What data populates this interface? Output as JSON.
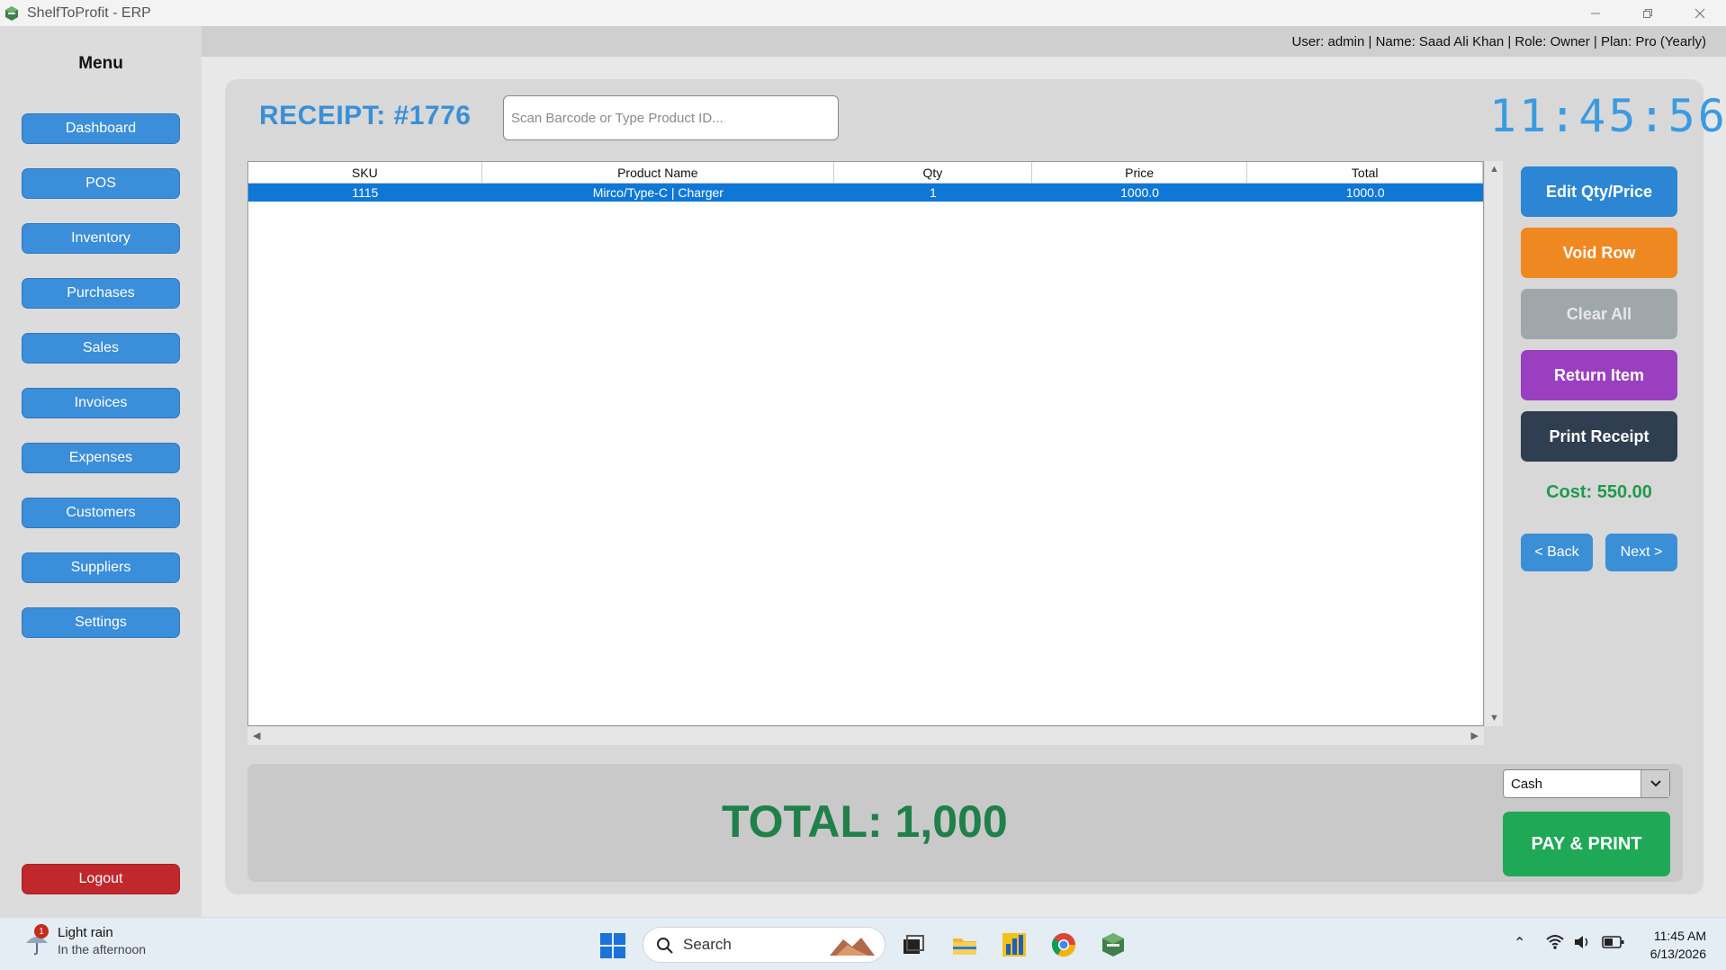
{
  "window": {
    "title": "ShelfToProfit - ERP"
  },
  "sidebar": {
    "menu_title": "Menu",
    "items": [
      {
        "label": "Dashboard"
      },
      {
        "label": "POS"
      },
      {
        "label": "Inventory"
      },
      {
        "label": "Purchases"
      },
      {
        "label": "Sales"
      },
      {
        "label": "Invoices"
      },
      {
        "label": "Expenses"
      },
      {
        "label": "Customers"
      },
      {
        "label": "Suppliers"
      },
      {
        "label": "Settings"
      }
    ],
    "logout_label": "Logout"
  },
  "header": {
    "user_info": "User: admin | Name: Saad Ali Khan | Role: Owner | Plan: Pro (Yearly)"
  },
  "pos": {
    "receipt_title": "RECEIPT: #1776",
    "scan_placeholder": "Scan Barcode or Type Product ID...",
    "clock": "11:45:56"
  },
  "table": {
    "columns": [
      "SKU",
      "Product Name",
      "Qty",
      "Price",
      "Total"
    ],
    "rows": [
      {
        "sku": "1115",
        "name": "Mirco/Type-C | Charger",
        "qty": "1",
        "price": "1000.0",
        "total": "1000.0",
        "selected": true
      }
    ]
  },
  "actions": {
    "edit": "Edit Qty/Price",
    "void": "Void Row",
    "clear": "Clear All",
    "return": "Return Item",
    "print": "Print Receipt",
    "cost": "Cost: 550.00",
    "back": "< Back",
    "next": "Next >"
  },
  "footer": {
    "total": "TOTAL: 1,000",
    "payment_method": "Cash",
    "pay_label": "PAY & PRINT"
  },
  "taskbar": {
    "weather_title": "Light rain",
    "weather_sub": "In the afternoon",
    "weather_badge": "1",
    "search_label": "Search",
    "time": "11:45 AM",
    "date": "6/13/2026"
  },
  "colors": {
    "accent_blue": "#3b8ed9",
    "void_orange": "#ef8820",
    "return_purple": "#9a3fc0",
    "print_dark": "#2f3e50",
    "total_green": "#1f8049",
    "pay_green": "#1fa856",
    "logout_red": "#c0282d"
  }
}
